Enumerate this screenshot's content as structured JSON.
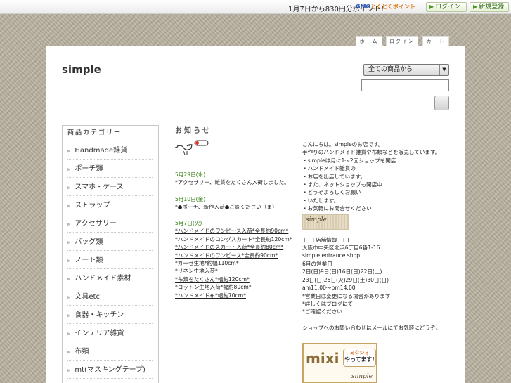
{
  "topbar": {
    "promo": "1月7日から830円分ポイント！",
    "gmo_brand": "GMO",
    "gmo_points": "とくとくポイント",
    "login": "ログイン",
    "register": "新規登録"
  },
  "nav": {
    "home": "ホーム",
    "login": "ログイン",
    "cart": "カート"
  },
  "shop": {
    "title": "simple"
  },
  "search": {
    "select_value": "全ての商品から",
    "input_value": ""
  },
  "sidebar": {
    "heading": "商品カテゴリー",
    "items": [
      "Handmade雑貨",
      "ポーチ類",
      "スマホ・ケース",
      "ストラップ",
      "アクセサリー",
      "バッグ類",
      "ノート類",
      "ハンドメイド素材",
      "文具etc",
      "食器・キッチン",
      "インテリア雑貨",
      "布類",
      "mt(マスキングテープ)"
    ]
  },
  "notice": {
    "heading": "お知らせ",
    "news": [
      {
        "date": "5月29日(水)",
        "lines": [
          {
            "text": "*アクセサリー、雑貨をたくさん入荷しました。",
            "u": false
          }
        ]
      },
      {
        "date": "5月10日(金)",
        "lines": [
          {
            "text": "*●ポーチ、新作入荷●ご覧ください（ま）",
            "u": false
          }
        ]
      },
      {
        "date": "5月7日(火)",
        "lines": [
          {
            "text": "*ハンドメイドのワンピース入荷*全長約90cm*",
            "u": true
          },
          {
            "text": "*ハンドメイドのロングスカート*全長約120cm*",
            "u": true
          },
          {
            "text": "*ハンドメイドのスカート入荷*全長約80cm*",
            "u": true
          },
          {
            "text": "*ハンドメイドのワンピース*全長約90cm*",
            "u": true
          },
          {
            "text": "*ガーゼ生地*約幅110cm*",
            "u": true
          },
          {
            "text": "*リネン生地入荷*",
            "u": false
          },
          {
            "text": "*布類をたくさん*幅約120cm*",
            "u": true
          },
          {
            "text": "*コットン生地入荷*幅約80cm*",
            "u": true
          },
          {
            "text": "*ハンドメイド布*幅約70cm*",
            "u": true
          }
        ]
      }
    ]
  },
  "right": {
    "intro_lines": [
      "こんにちは。simpleのお店です。",
      "手作りのハンドメイド雑貨や布類などを販売しています。",
      "・simpleは月に1～2回ショップを開店",
      "・ハンドメイド雑貨の",
      "・お店を出店しています。",
      "・また、ネットショップも開店中",
      "・どうぞよろしくお願い",
      "・いたします。",
      "・お気軽にお問合せください"
    ],
    "logo_text": "simple",
    "event_lines": [
      "+++店舗情報+++",
      "大阪市中央区北浜6丁目6番1-16",
      "simple entrance shop",
      "6月の営業日",
      "2日(日)9日(日)16日(日)22日(土)",
      "23日(日)25日(火)29日(土)30日(日)",
      "am11:00～pm14:00",
      "*営業日は変更になる場合があります",
      "*詳しくはブログにて",
      "*ご確認ください"
    ],
    "closing": "ショップへのお問い合わせはメールにてお気軽にどうぞ。",
    "mixi": {
      "logo": "mixi",
      "badge_top": "ミクシィ",
      "badge_bottom": "やってます!",
      "tag": "simple"
    }
  }
}
